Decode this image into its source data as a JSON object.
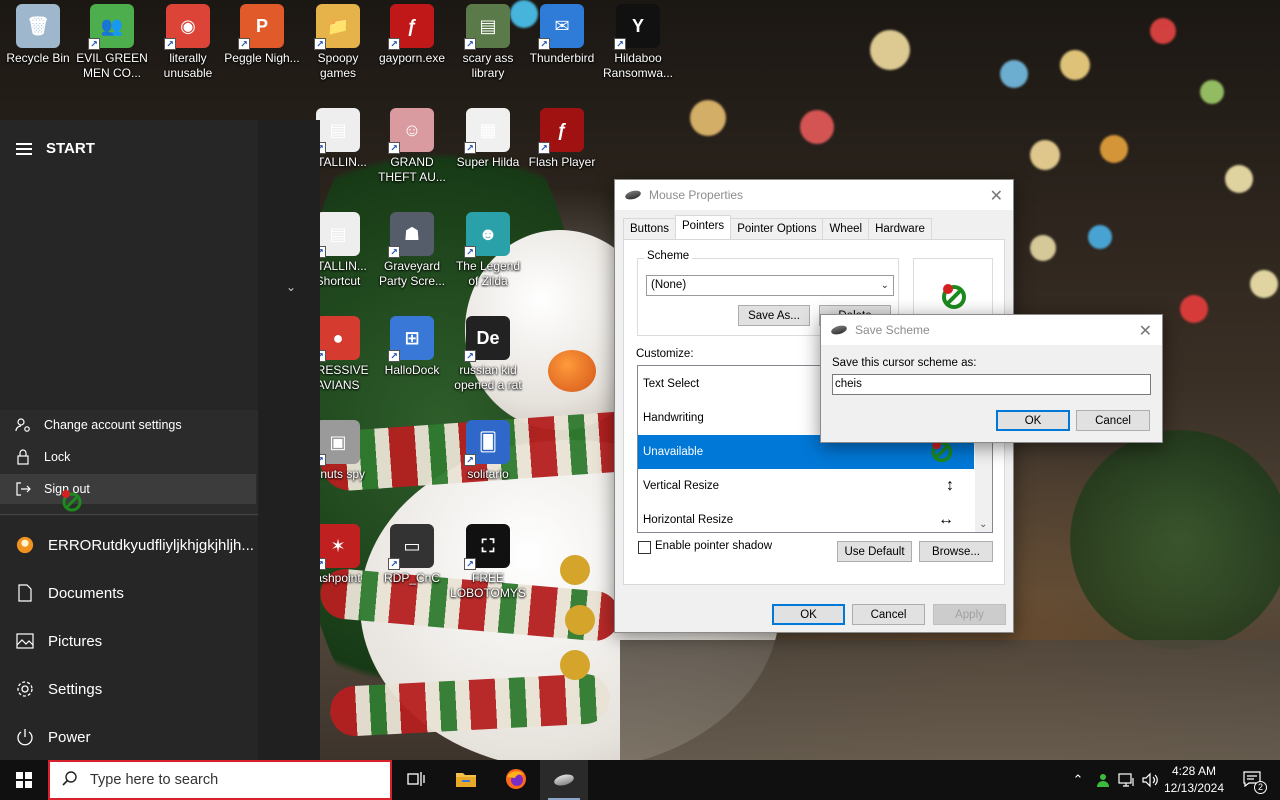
{
  "desktop": {
    "icons": [
      {
        "label": "Recycle Bin",
        "icon": "recycle-bin-icon",
        "color": "#9fb7cc",
        "glyph": "🗑"
      },
      {
        "label": "EVIL GREEN MEN CO...",
        "icon": "people-icon",
        "color": "#4cae4c",
        "glyph": "👥"
      },
      {
        "label": "literally unusable",
        "icon": "chrome-icon",
        "color": "#db4437",
        "glyph": "◉"
      },
      {
        "label": "Peggle Nigh...",
        "icon": "peggle-icon",
        "color": "#e05a2a",
        "glyph": "P"
      },
      {
        "label": "Spoopy games",
        "icon": "folder-icon",
        "color": "#e5b34a",
        "glyph": "📁"
      },
      {
        "label": "gayporn.exe",
        "icon": "flash-icon",
        "color": "#c01818",
        "glyph": "ƒ"
      },
      {
        "label": "scary ass library",
        "icon": "library-icon",
        "color": "#5b7a4a",
        "glyph": "▤"
      },
      {
        "label": "Thunderbird",
        "icon": "thunderbird-icon",
        "color": "#2f7bd8",
        "glyph": "✉"
      },
      {
        "label": "Hildaboo Ransomwa...",
        "icon": "yashma-icon",
        "color": "#111111",
        "glyph": "Y"
      },
      {
        "label": "STALLIN...",
        "icon": "document-icon",
        "color": "#eeeeee",
        "glyph": "▤"
      },
      {
        "label": "GRAND THEFT AU...",
        "icon": "anime-icon",
        "color": "#d99aa0",
        "glyph": "☺"
      },
      {
        "label": "Super Hilda",
        "icon": "pixel-icon",
        "color": "#f0f0f0",
        "glyph": "▦"
      },
      {
        "label": "Flash Player",
        "icon": "flash-icon",
        "color": "#a01212",
        "glyph": "ƒ"
      },
      {
        "label": "STALLIN... Shortcut",
        "icon": "document-icon",
        "color": "#eeeeee",
        "glyph": "▤"
      },
      {
        "label": "Graveyard Party Scre...",
        "icon": "robot-icon",
        "color": "#555c6a",
        "glyph": "☗"
      },
      {
        "label": "The Legend of Zilda",
        "icon": "zilda-icon",
        "color": "#2aa0a8",
        "glyph": "☻"
      },
      {
        "label": "GRESSIVE AVIANS",
        "icon": "angry-bird-icon",
        "color": "#d63b2f",
        "glyph": "●"
      },
      {
        "label": "HalloDock",
        "icon": "windows-shield-icon",
        "color": "#3a78d8",
        "glyph": "⊞"
      },
      {
        "label": "russian kid opened a rat",
        "icon": "de-icon",
        "color": "#222222",
        "glyph": "De"
      },
      {
        "label": "z nuts spy",
        "icon": "windows-icon",
        "color": "#9a9a9a",
        "glyph": "▣"
      },
      {
        "label": "solitario",
        "icon": "cards-icon",
        "color": "#2f68c9",
        "glyph": "🂠"
      },
      {
        "label": "ashpoint",
        "icon": "flashpoint-icon",
        "color": "#c02020",
        "glyph": "✶"
      },
      {
        "label": "RDP_CnC",
        "icon": "rdp-icon",
        "color": "#333333",
        "glyph": "▭"
      },
      {
        "label": "FREE LOBOTOMYS",
        "icon": "lobotomy-icon",
        "color": "#111111",
        "glyph": "⛶"
      }
    ]
  },
  "start_menu": {
    "title": "START",
    "account_menu": [
      {
        "label": "Change account settings",
        "icon": "account-settings-icon"
      },
      {
        "label": "Lock",
        "icon": "lock-icon"
      },
      {
        "label": "Sign out",
        "icon": "sign-out-icon"
      }
    ],
    "user_name": "ERRORutdkyudfliyljkhjgkjhljh...",
    "items": [
      {
        "label": "Documents",
        "icon": "document-icon"
      },
      {
        "label": "Pictures",
        "icon": "pictures-icon"
      },
      {
        "label": "Settings",
        "icon": "gear-icon"
      },
      {
        "label": "Power",
        "icon": "power-icon"
      }
    ]
  },
  "mouse_properties": {
    "title": "Mouse Properties",
    "tabs": [
      "Buttons",
      "Pointers",
      "Pointer Options",
      "Wheel",
      "Hardware"
    ],
    "active_tab": "Pointers",
    "scheme_label": "Scheme",
    "scheme_value": "(None)",
    "save_as_label": "Save As...",
    "delete_label": "Delete",
    "customize_label": "Customize:",
    "pointer_list": [
      {
        "label": "Text Select",
        "cursor": ""
      },
      {
        "label": "Handwriting",
        "cursor": ""
      },
      {
        "label": "Unavailable",
        "cursor": "🚫",
        "selected": true
      },
      {
        "label": "Vertical Resize",
        "cursor": "↕"
      },
      {
        "label": "Horizontal Resize",
        "cursor": "↔"
      }
    ],
    "enable_shadow_label": "Enable pointer shadow",
    "use_default_label": "Use Default",
    "browse_label": "Browse...",
    "ok_label": "OK",
    "cancel_label": "Cancel",
    "apply_label": "Apply"
  },
  "save_scheme": {
    "title": "Save Scheme",
    "prompt": "Save this cursor scheme as:",
    "value": "cheis",
    "ok_label": "OK",
    "cancel_label": "Cancel"
  },
  "taskbar": {
    "search_placeholder": "Type here to search",
    "time": "4:28 AM",
    "date": "12/13/2024",
    "notification_count": "2"
  },
  "colors": {
    "accent": "#0078d7",
    "search_border": "#d9212c"
  }
}
